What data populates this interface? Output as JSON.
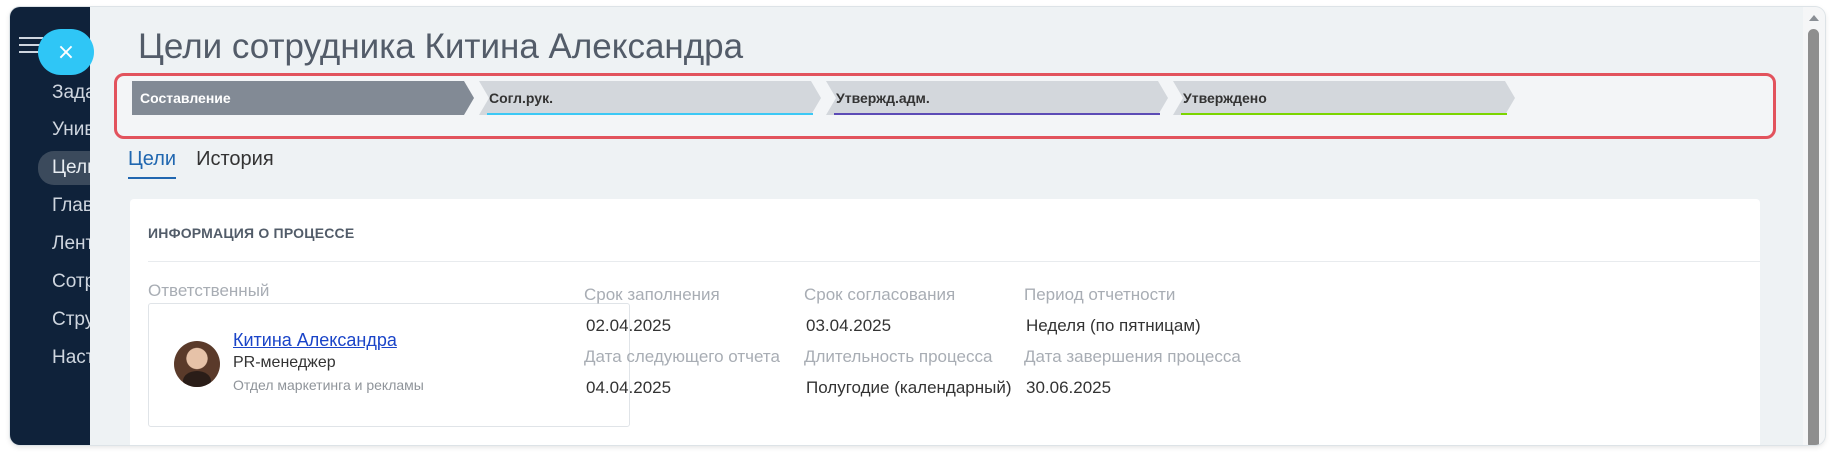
{
  "sidebar": {
    "items": [
      "Зада",
      "Унив",
      "Цели",
      "Глав",
      "Лент",
      "Сотр",
      "Стру",
      "Наст"
    ],
    "active_index": 2,
    "menu_icon": "hamburger-icon",
    "close_icon": "close-icon",
    "close_label": "×"
  },
  "page": {
    "title": "Цели сотрудника Китина Александра"
  },
  "stages": [
    {
      "label": "Составление",
      "color": "#828a95",
      "active": true
    },
    {
      "label": "Согл.рук.",
      "color": "#3bc8f5",
      "active": false
    },
    {
      "label": "Утвержд.адм.",
      "color": "#5c4bb6",
      "active": false
    },
    {
      "label": "Утверждено",
      "color": "#7bd500",
      "active": false
    }
  ],
  "tabs": [
    {
      "label": "Цели",
      "active": true
    },
    {
      "label": "История",
      "active": false
    }
  ],
  "process_info": {
    "heading": "ИНФОРМАЦИЯ О ПРОЦЕССЕ",
    "responsible_label": "Ответственный",
    "responsible": {
      "name": "Китина Александра",
      "position": "PR-менеджер",
      "department": "Отдел маркетинга и рекламы"
    },
    "fields": [
      {
        "label": "Срок заполнения",
        "value": "02.04.2025"
      },
      {
        "label": "Срок согласования",
        "value": "03.04.2025"
      },
      {
        "label": "Период отчетности",
        "value": "Неделя (по пятницам)"
      },
      {
        "label": "Дата следующего отчета",
        "value": "04.04.2025"
      },
      {
        "label": "Длительность процесса",
        "value": "Полугодие (календарный)"
      },
      {
        "label": "Дата завершения процесса",
        "value": "30.06.2025"
      }
    ]
  }
}
